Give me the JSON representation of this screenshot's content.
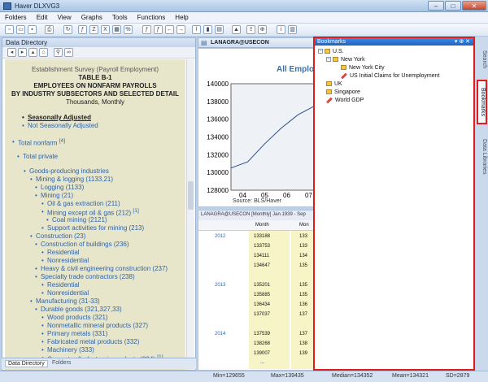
{
  "app": {
    "title": "Haver DLXVG3"
  },
  "menu": [
    "Folders",
    "Edit",
    "View",
    "Graphs",
    "Tools",
    "Functions",
    "Help"
  ],
  "data_directory": {
    "panel_title": "Data Directory",
    "header_lines": [
      "Establishment Survey (Payroll Employment)",
      "TABLE B-1",
      "EMPLOYEES ON NONFARM PAYROLLS",
      "BY INDUSTRY SUBSECTORS AND SELECTED DETAIL",
      "Thousands, Monthly"
    ],
    "adjust_options": [
      "Seasonally Adjusted",
      "Not Seasonally Adjusted"
    ],
    "tree": [
      {
        "label": "Total nonfarm",
        "note": "[4]"
      },
      {
        "label": "Total private"
      },
      {
        "label": "Goods-producing industries"
      },
      {
        "label": "Mining & logging (1133,21)"
      },
      {
        "label": "Logging (1133)"
      },
      {
        "label": "Mining (21)"
      },
      {
        "label": "Oil & gas extraction (211)"
      },
      {
        "label": "Mining except oil & gas (212)",
        "note": "[1]"
      },
      {
        "label": "Coal mining (2121)"
      },
      {
        "label": "Support activities for mining (213)"
      },
      {
        "label": "Construction (23)"
      },
      {
        "label": "Construction of buildings (236)"
      },
      {
        "label": "Residential"
      },
      {
        "label": "Nonresidential"
      },
      {
        "label": "Heavy & civil engineering construction (237)"
      },
      {
        "label": "Specialty trade contractors (238)"
      },
      {
        "label": "Residential"
      },
      {
        "label": "Nonresidential"
      },
      {
        "label": "Manufacturing (31-33)"
      },
      {
        "label": "Durable goods (321,327,33)"
      },
      {
        "label": "Wood products (321)"
      },
      {
        "label": "Nonmetallic mineral products (327)"
      },
      {
        "label": "Primary metals (331)"
      },
      {
        "label": "Fabricated metal products (332)"
      },
      {
        "label": "Machinery (333)"
      },
      {
        "label": "Computer & electronic products (334)",
        "note": "[1]"
      }
    ],
    "footer_tabs": [
      "Data Directory",
      "Folders"
    ]
  },
  "graph": {
    "tab_label": "LANAGRA@USECON",
    "title": "All Employ",
    "y_ticks": [
      "140000",
      "138000",
      "136000",
      "134000",
      "132000",
      "130000",
      "128000"
    ],
    "x_ticks": [
      "04",
      "05",
      "06",
      "07"
    ],
    "source": "Source:  BLS/Haver",
    "chart_data": {
      "type": "line",
      "title": "All Employ",
      "x": [
        "04",
        "05",
        "06",
        "07"
      ],
      "ylim": [
        128000,
        140000
      ],
      "series": [
        {
          "values": [
            130500,
            131200,
            133200,
            135000,
            136500,
            137500
          ]
        }
      ]
    }
  },
  "grid": {
    "header": "LANAGRA@USECON   [Monthly]  Jan.1939 - Sep",
    "col_headers": [
      "Month",
      "Mon"
    ],
    "years": [
      "2012",
      "2013",
      "2014"
    ],
    "rows_2012": [
      "133188",
      "133753",
      "134111",
      "134647"
    ],
    "rows_2013": [
      "135201",
      "135885",
      "136434",
      "137037"
    ],
    "rows_2014": [
      "137539",
      "138268",
      "139007"
    ],
    "ellipsis": "...",
    "more_2012": [
      "133",
      "133",
      "134",
      "135"
    ],
    "more_2013": [
      "135",
      "135",
      "136",
      "137"
    ],
    "more_2014": [
      "137",
      "138",
      "139"
    ]
  },
  "bookmarks": {
    "title": "Bookmarks",
    "items": [
      {
        "label": "U.S.",
        "type": "folder"
      },
      {
        "label": "New York",
        "type": "folder"
      },
      {
        "label": "New York City",
        "type": "folder"
      },
      {
        "label": "US Initial Claims for Unemployment",
        "type": "series"
      },
      {
        "label": "UK",
        "type": "folder"
      },
      {
        "label": "Singapore",
        "type": "folder"
      },
      {
        "label": "World GDP",
        "type": "series"
      }
    ]
  },
  "right_tabs": [
    "Search",
    "Bookmarks",
    "Data Libraries"
  ],
  "status": {
    "min": "Min=129655",
    "max": "Max=139435",
    "median": "Median=134352",
    "mean": "Mean=134321",
    "sd": "SD=2879"
  },
  "colors": {
    "accent": "#2f63a8",
    "highlight": "#e31b1b"
  }
}
